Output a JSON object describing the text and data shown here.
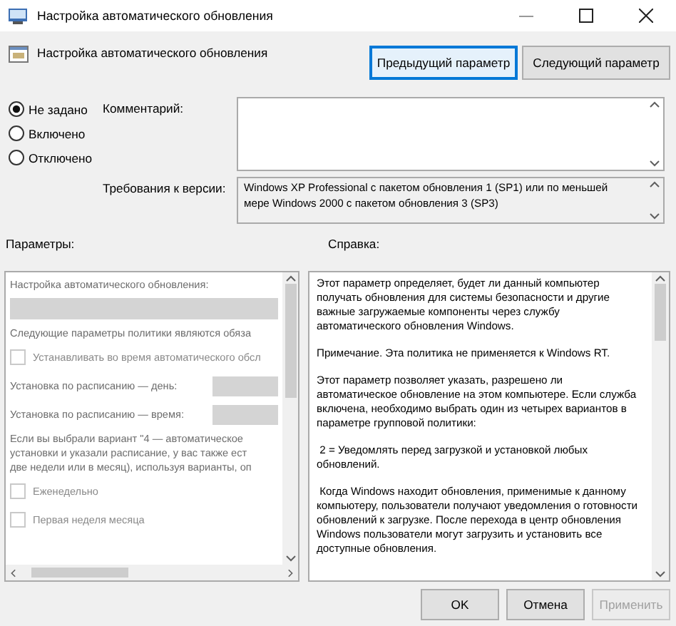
{
  "window": {
    "title": "Настройка автоматического обновления"
  },
  "header": {
    "title": "Настройка автоматического обновления",
    "buttons": [
      {
        "label": "Предыдущий параметр",
        "selected": true
      },
      {
        "label": "Следующий параметр",
        "selected": false
      }
    ]
  },
  "state_options": [
    {
      "label": "Не задано",
      "selected": true
    },
    {
      "label": "Включено",
      "selected": false
    },
    {
      "label": "Отключено",
      "selected": false
    }
  ],
  "comment": {
    "label": "Комментарий:"
  },
  "requirements": {
    "label": "Требования к версии:",
    "lines": [
      "Windows XP Professional с пакетом обновления 1 (SP1) или по меньшей",
      "мере Windows 2000 с пакетом обновления 3 (SP3)"
    ]
  },
  "parameters": {
    "label": "Параметры:",
    "items": [
      {
        "kind": "text",
        "text": "Настройка автоматического обновления:"
      },
      {
        "kind": "select"
      },
      {
        "kind": "text",
        "text": "Следующие параметры политики являются обяза"
      },
      {
        "kind": "checkbox",
        "text": "Устанавливать во время автоматического обсл",
        "checked": false
      },
      {
        "kind": "field",
        "text": "Установка по расписанию — день:"
      },
      {
        "kind": "field",
        "text": "Установка по расписанию — время:"
      },
      {
        "kind": "text",
        "text": "Если вы выбрали вариант \"4 — автоматическое"
      },
      {
        "kind": "line",
        "text": "установки и указали расписание, у вас также ест"
      },
      {
        "kind": "line",
        "text": "две недели или в месяц), используя варианты, оп"
      },
      {
        "kind": "checkbox",
        "text": "Еженедельно",
        "checked": false
      },
      {
        "kind": "checkbox",
        "text": "Первая неделя месяца",
        "checked": false
      }
    ]
  },
  "help": {
    "label": "Справка:",
    "paragraphs": [
      "Этот параметр определяет, будет ли данный компьютер получать обновления для системы безопасности и другие важные загружаемые компоненты через службу автоматического обновления Windows.",
      "Примечание. Эта политика не применяется к Windows RT.",
      "Этот параметр позволяет указать, разрешено ли автоматическое обновление на этом компьютере. Если служба включена, необходимо выбрать один из четырех вариантов в параметре групповой политики:",
      " 2 = Уведомлять перед загрузкой и установкой любых обновлений.",
      " Когда Windows находит обновления, применимые к данному компьютеру, пользователи получают уведомления о готовности обновлений к загрузке. После перехода в центр обновления Windows пользователи могут загрузить и установить все доступные обновления."
    ]
  },
  "footer_buttons": [
    {
      "label": "OK",
      "disabled": false
    },
    {
      "label": "Отмена",
      "disabled": false
    },
    {
      "label": "Применить",
      "disabled": true
    }
  ]
}
